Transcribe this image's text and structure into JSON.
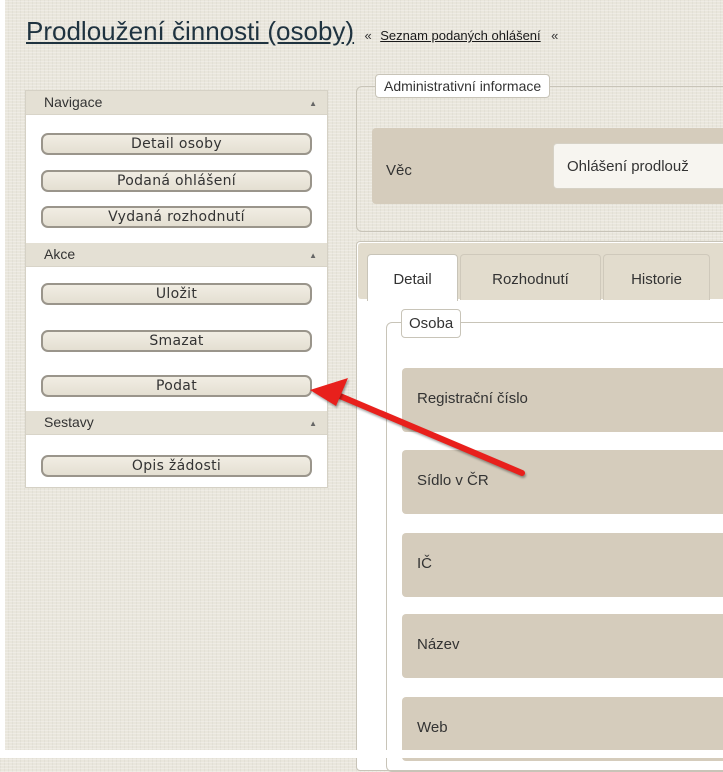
{
  "header": {
    "title": "Prodloužení činnosti (osoby)",
    "breadcrumb_sep": "«",
    "breadcrumb_link": "Seznam podaných ohlášení",
    "breadcrumb_sep2": "«"
  },
  "sidebar": {
    "sections": [
      {
        "label": "Navigace",
        "items": [
          "Detail osoby",
          "Podaná ohlášení",
          "Vydaná rozhodnutí"
        ]
      },
      {
        "label": "Akce",
        "items": [
          "Uložit",
          "Smazat",
          "Podat"
        ]
      },
      {
        "label": "Sestavy",
        "items": [
          "Opis žádosti"
        ]
      }
    ],
    "collapse_glyph": "▲"
  },
  "admin": {
    "legend": "Administrativní informace",
    "vec_label": "Věc",
    "vec_value": "Ohlášení prodlouž"
  },
  "tabs": [
    {
      "label": "Detail",
      "active": true
    },
    {
      "label": "Rozhodnutí",
      "active": false
    },
    {
      "label": "Historie",
      "active": false
    }
  ],
  "osoba": {
    "legend": "Osoba",
    "fields": [
      "Registrační číslo",
      "Sídlo v ČR",
      "IČ",
      "Název",
      "Web"
    ]
  },
  "colors": {
    "annotation_arrow": "#e8201c",
    "panel_beige": "#d5ccbc",
    "button_border": "#9a958b"
  }
}
